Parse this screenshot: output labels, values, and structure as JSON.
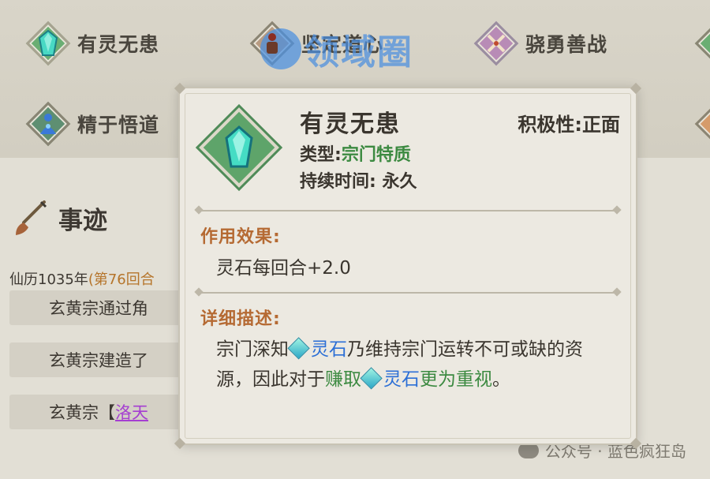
{
  "traits": [
    {
      "label": "有灵无患",
      "icon": "spirit-crystal-icon"
    },
    {
      "label": "坚定道心",
      "icon": "steadfast-heart-icon"
    },
    {
      "label": "骁勇善战",
      "icon": "crossed-swords-icon"
    },
    {
      "label": "精于悟道",
      "icon": "meditating-figure-icon"
    }
  ],
  "section": {
    "title": "事迹"
  },
  "history": {
    "date": "仙历1035年",
    "turn": "(第76回合",
    "rows": [
      {
        "text": "玄黄宗通过角"
      },
      {
        "text": "玄黄宗建造了"
      },
      {
        "prefix": "玄黄宗【",
        "link": "洛天"
      }
    ]
  },
  "tooltip": {
    "name": "有灵无患",
    "positivity": "积极性:正面",
    "type_label": "类型:",
    "type_value": "宗门特质",
    "duration": "持续时间: 永久",
    "effect_label": "作用效果:",
    "effect_text": "灵石每回合+2.0",
    "desc_label": "详细描述:",
    "desc": {
      "p1": "宗门深知",
      "stone1": "灵石",
      "p2": "乃维持宗门运转不可或缺的资源，因此对于",
      "earn": "赚取",
      "stone2": "灵石",
      "p3": "更为重视",
      "end": "。"
    }
  },
  "watermark": {
    "top": "领域圈",
    "bottom": "公众号 · 蓝色疯狂岛"
  },
  "colors": {
    "type_green": "#3c8a41",
    "link_purple": "#a53fd1",
    "stone_blue": "#2c6fd6",
    "label_orange": "#b56a33"
  }
}
